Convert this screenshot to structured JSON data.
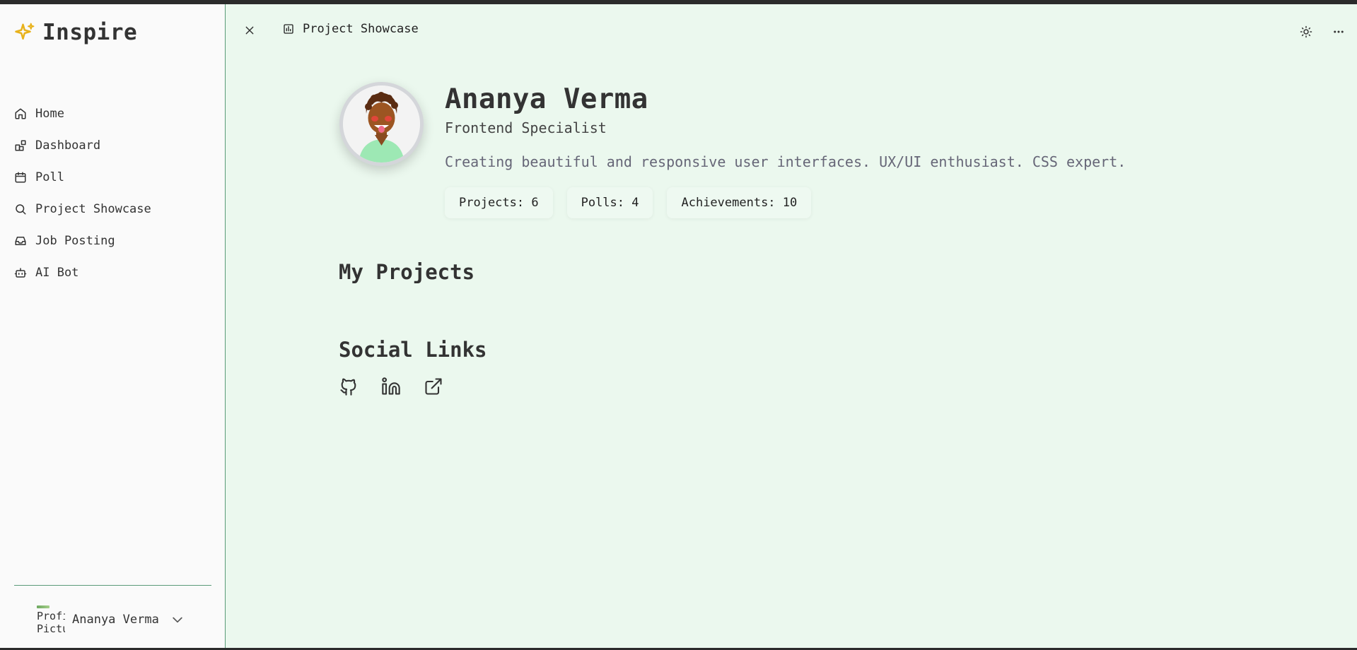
{
  "app": {
    "brand": "Inspire"
  },
  "sidebar": {
    "items": [
      {
        "label": "Home",
        "icon": "home-icon"
      },
      {
        "label": "Dashboard",
        "icon": "dashboard-icon"
      },
      {
        "label": "Poll",
        "icon": "calendar-icon"
      },
      {
        "label": "Project Showcase",
        "icon": "search-icon"
      },
      {
        "label": "Job Posting",
        "icon": "inbox-icon"
      },
      {
        "label": "AI Bot",
        "icon": "bot-icon"
      }
    ],
    "user": {
      "avatar_alt": "Profile Picture",
      "name": "Ananya Verma"
    }
  },
  "topbar": {
    "title": "Project Showcase"
  },
  "profile": {
    "name": "Ananya Verma",
    "role": "Frontend Specialist",
    "bio": "Creating beautiful and responsive user interfaces. UX/UI enthusiast. CSS expert.",
    "stats": [
      {
        "label": "Projects: 6"
      },
      {
        "label": "Polls: 4"
      },
      {
        "label": "Achievements: 10"
      }
    ]
  },
  "sections": {
    "projects_title": "My Projects",
    "social_title": "Social Links"
  },
  "social": [
    {
      "icon": "github-icon"
    },
    {
      "icon": "linkedin-icon"
    },
    {
      "icon": "external-link-icon"
    }
  ],
  "colors": {
    "accent": "#5a9a78",
    "main_bg": "#ebf8ee",
    "sidebar_bg": "#fafafa",
    "brand_star": "#e8b21c"
  }
}
